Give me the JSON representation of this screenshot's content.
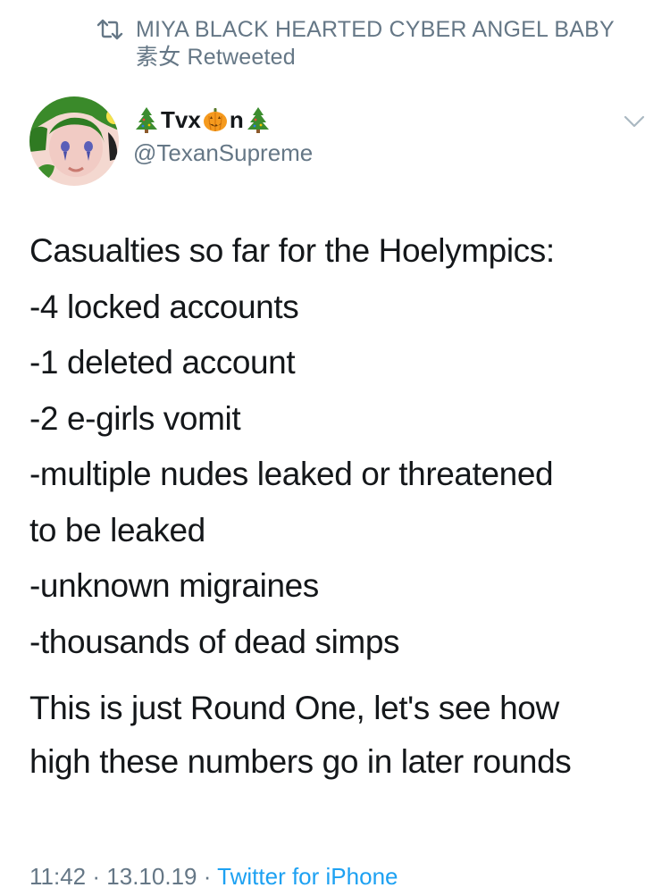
{
  "retweet": {
    "icon": "retweet-icon",
    "line1": "MIYA BLACK HEARTED CYBER ANGEL BABY",
    "line2": "素女 Retweeted"
  },
  "author": {
    "avatar_icon": "avatar-image",
    "name_prefix_emoji": "christmas-tree-icon",
    "name_part1": "Tvx",
    "name_middle_emoji": "jack-o-lantern-icon",
    "name_part2": "n",
    "name_suffix_emoji": "christmas-tree-icon",
    "handle": "@TexanSupreme"
  },
  "menu": {
    "icon": "chevron-down-icon"
  },
  "tweet": {
    "lines": [
      "Casualties so far for the Hoelympics:",
      "-4 locked accounts",
      "-1 deleted account",
      "-2 e-girls vomit",
      "-multiple nudes leaked or threatened",
      "to be leaked",
      "-unknown migraines",
      "-thousands of dead simps"
    ],
    "closing_lines": [
      "This is just Round One, let's see how",
      "high these numbers go in later rounds"
    ]
  },
  "meta": {
    "time": "11:42",
    "separator": "·",
    "date": "13.10.19",
    "source": "Twitter for iPhone"
  },
  "colors": {
    "text": "#14171a",
    "muted": "#657786",
    "link": "#1da1f2"
  }
}
